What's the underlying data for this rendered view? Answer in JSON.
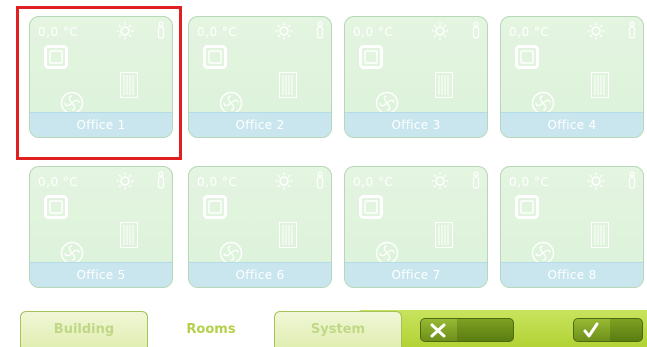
{
  "rooms": [
    {
      "name": "Office 1",
      "temperature": "0,0 °C",
      "selected": true
    },
    {
      "name": "Office 2",
      "temperature": "0,0 °C",
      "selected": false
    },
    {
      "name": "Office 3",
      "temperature": "0,0 °C",
      "selected": false
    },
    {
      "name": "Office 4",
      "temperature": "0,0 °C",
      "selected": false
    },
    {
      "name": "Office 5",
      "temperature": "0,0 °C",
      "selected": false
    },
    {
      "name": "Office 6",
      "temperature": "0,0 °C",
      "selected": false
    },
    {
      "name": "Office 7",
      "temperature": "0,0 °C",
      "selected": false
    },
    {
      "name": "Office 8",
      "temperature": "0,0 °C",
      "selected": false
    }
  ],
  "tile_icons": [
    "sun-icon",
    "person-icon",
    "window-icon",
    "radiator-icon",
    "fan-icon"
  ],
  "tabs": [
    {
      "label": "Building",
      "active": false
    },
    {
      "label": "Rooms",
      "active": true
    },
    {
      "label": "System",
      "active": false
    }
  ],
  "actions": {
    "cancel_icon": "close-icon",
    "ok_icon": "checkmark-icon"
  },
  "colors": {
    "tile_bg": "#dcf2d9",
    "label_bar": "#c9e6ef",
    "selection": "#e02020",
    "accent_green": "#b2d234",
    "button_green": "#5a7d12"
  }
}
